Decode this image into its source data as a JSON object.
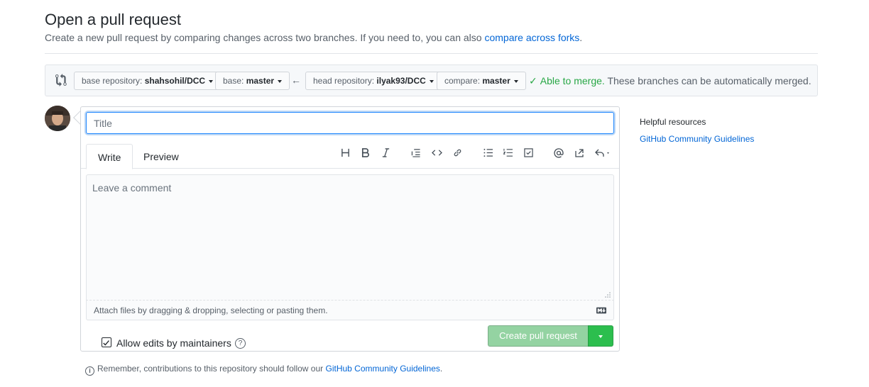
{
  "header": {
    "title": "Open a pull request",
    "description": "Create a new pull request by comparing changes across two branches. If you need to, you can also ",
    "description_link": "compare across forks",
    "description_end": "."
  },
  "range": {
    "base_repo_label": "base repository:",
    "base_repo_value": "shahsohil/DCC",
    "base_label": "base:",
    "base_value": "master",
    "head_repo_label": "head repository:",
    "head_repo_value": "ilyak93/DCC",
    "compare_label": "compare:",
    "compare_value": "master",
    "merge_status": "Able to merge.",
    "merge_detail": "These branches can be automatically merged."
  },
  "form": {
    "title_placeholder": "Title",
    "tabs": [
      "Write",
      "Preview"
    ],
    "comment_placeholder": "Leave a comment",
    "attach_text": "Attach files by dragging & dropping, selecting or pasting them.",
    "maintainers_label": "Allow edits by maintainers",
    "maintainers_checked": true,
    "create_button": "Create pull request",
    "toolbar_icons": [
      "header-icon",
      "bold-icon",
      "italic-icon",
      "quote-icon",
      "code-icon",
      "link-icon",
      "unordered-list-icon",
      "ordered-list-icon",
      "task-list-icon",
      "mention-icon",
      "cross-reference-icon",
      "reply-icon"
    ]
  },
  "sidebar": {
    "title": "Helpful resources",
    "link": "GitHub Community Guidelines"
  },
  "footer": {
    "note": "Remember, contributions to this repository should follow our ",
    "link": "GitHub Community Guidelines",
    "end": "."
  },
  "colors": {
    "link": "#0366d6",
    "success": "#28a745",
    "create_disabled": "#94d3a2",
    "create_caret": "#2cbe4e",
    "focus": "#2188ff"
  }
}
